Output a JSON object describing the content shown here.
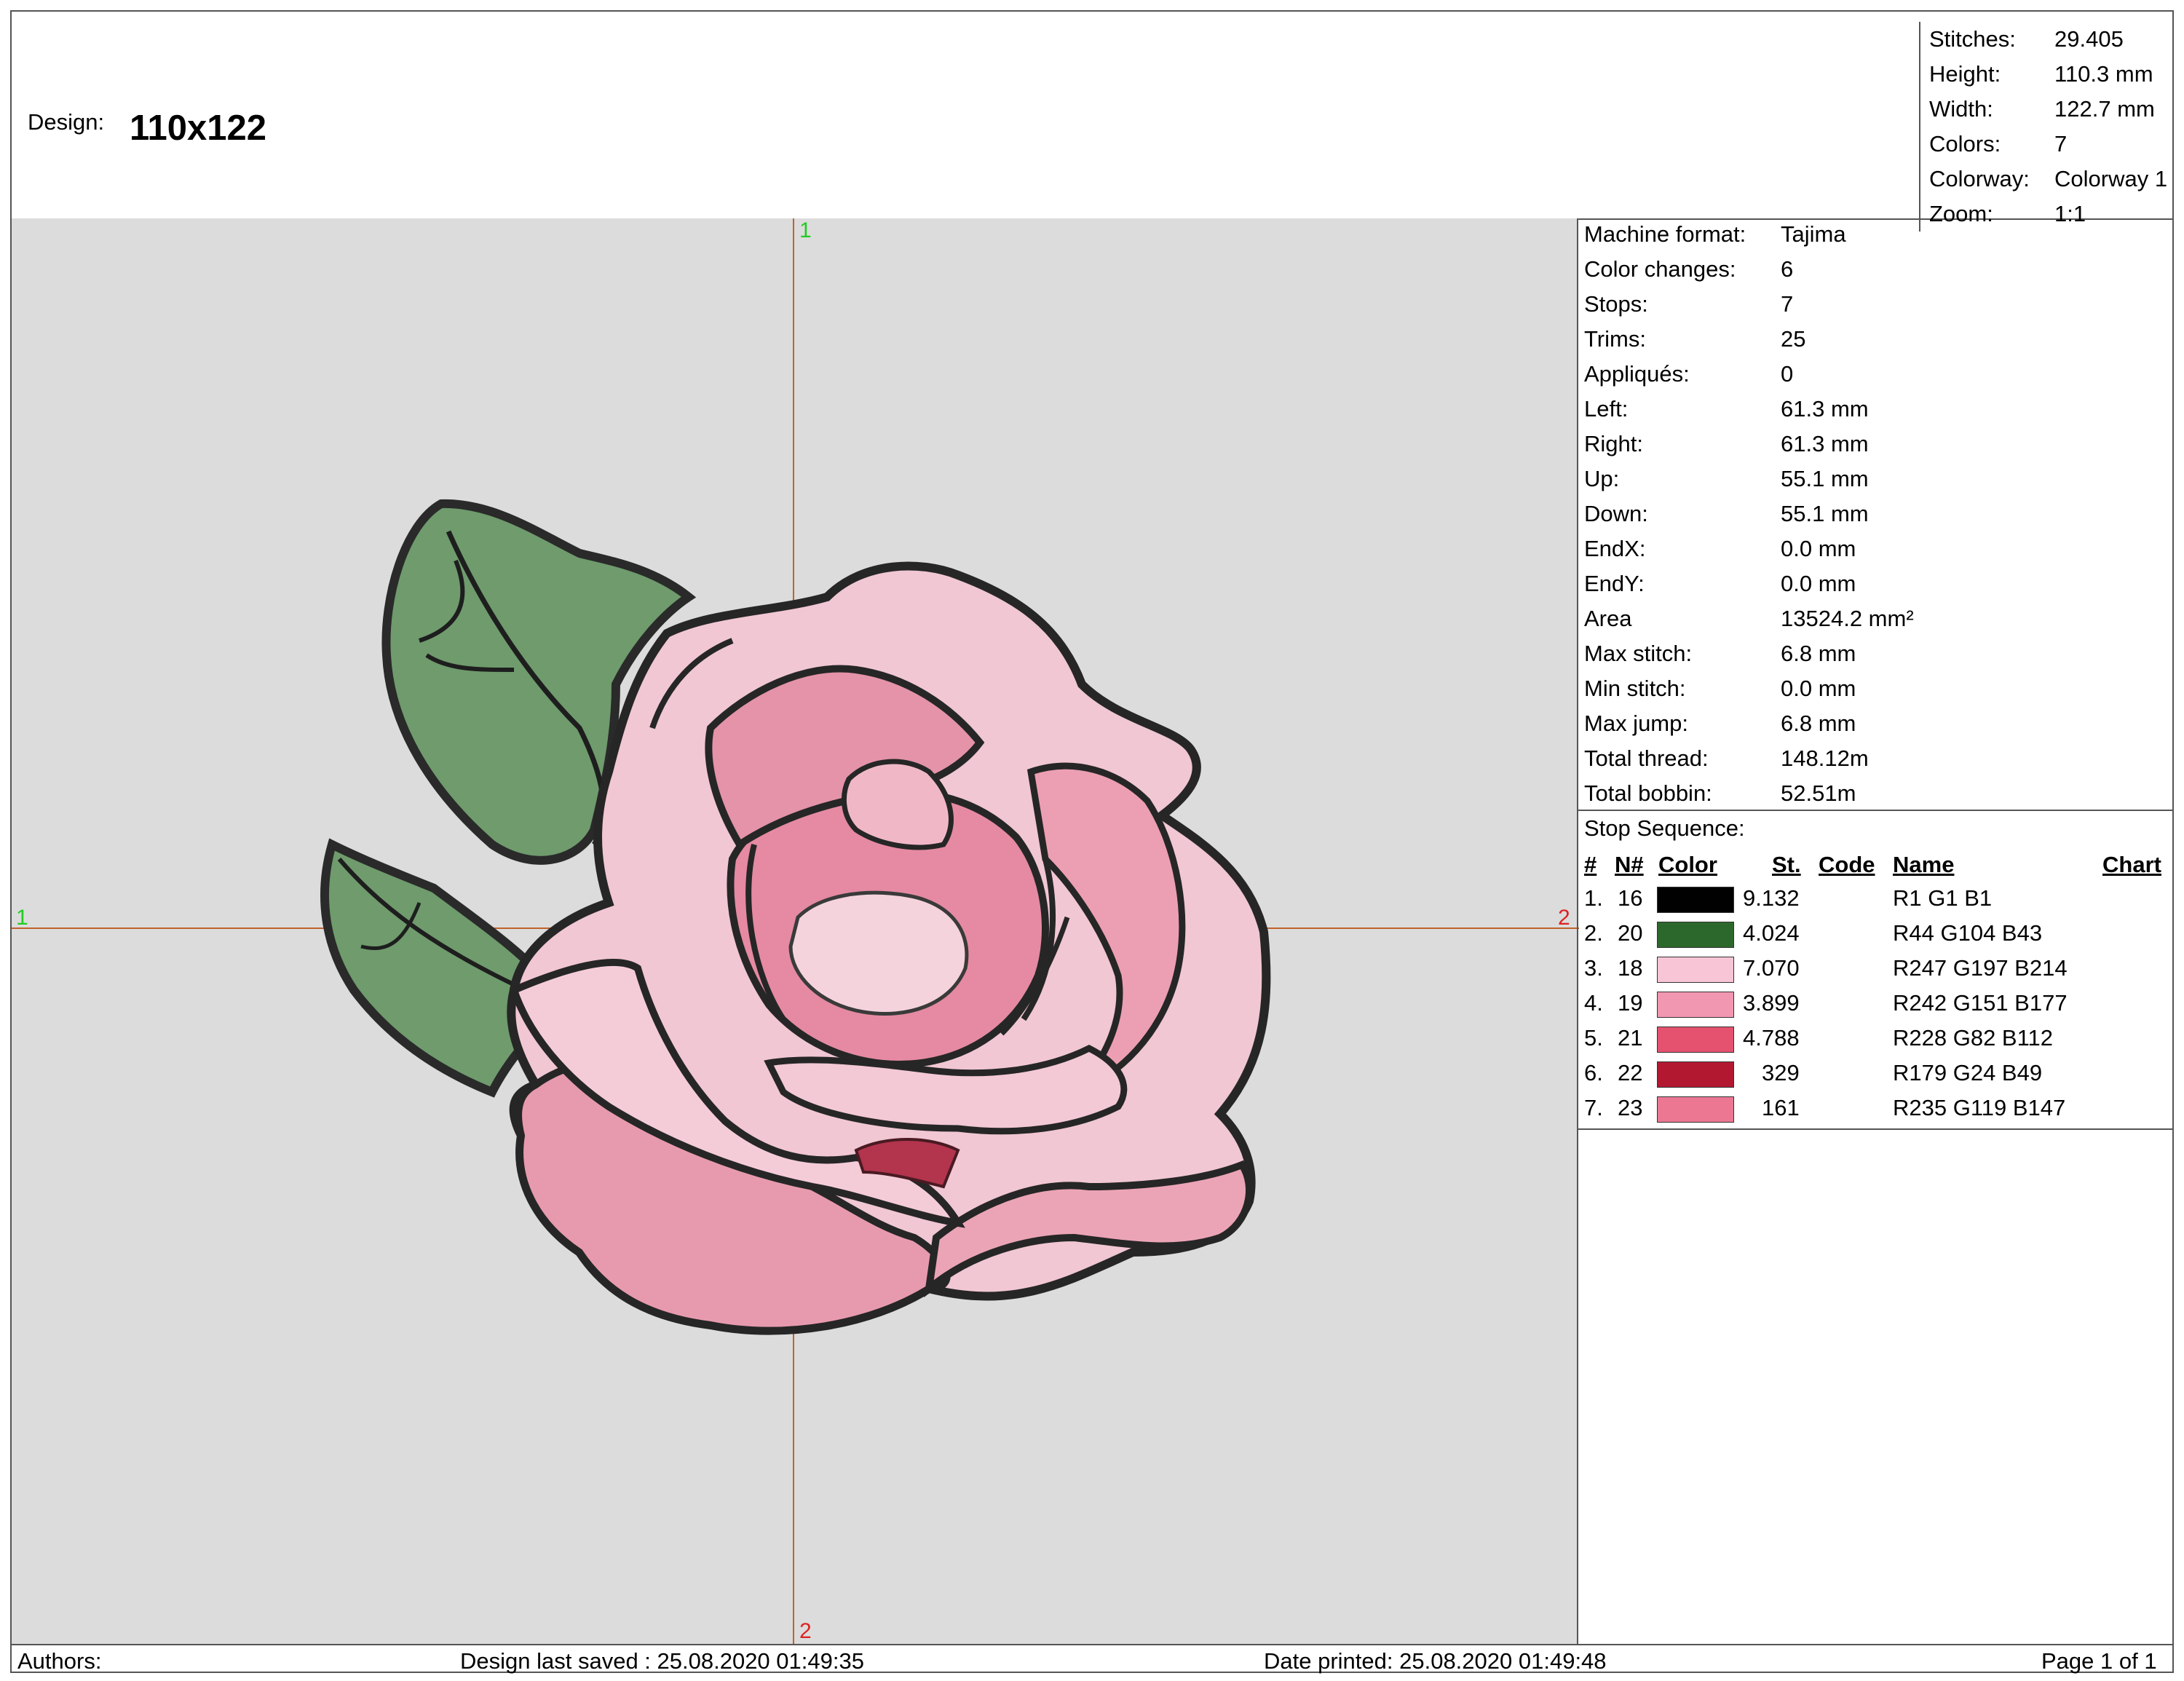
{
  "header": {
    "design_label": "Design:",
    "design_name": "110x122"
  },
  "summary": [
    {
      "label": "Stitches:",
      "value": "29.405"
    },
    {
      "label": "Height:",
      "value": "110.3 mm"
    },
    {
      "label": "Width:",
      "value": "122.7 mm"
    },
    {
      "label": "Colors:",
      "value": "7"
    },
    {
      "label": "Colorway:",
      "value": "Colorway 1"
    },
    {
      "label": "Zoom:",
      "value": "1:1"
    }
  ],
  "info": [
    {
      "label": "Machine format:",
      "value": "Tajima"
    },
    {
      "label": "Color changes:",
      "value": "6"
    },
    {
      "label": "Stops:",
      "value": "7"
    },
    {
      "label": "Trims:",
      "value": "25"
    },
    {
      "label": "Appliqués:",
      "value": "0"
    },
    {
      "label": "Left:",
      "value": "61.3 mm"
    },
    {
      "label": "Right:",
      "value": "61.3 mm"
    },
    {
      "label": "Up:",
      "value": "55.1 mm"
    },
    {
      "label": "Down:",
      "value": "55.1 mm"
    },
    {
      "label": "EndX:",
      "value": "0.0 mm"
    },
    {
      "label": "EndY:",
      "value": "0.0 mm"
    },
    {
      "label": "Area",
      "value": "13524.2 mm²"
    },
    {
      "label": "Max stitch:",
      "value": "6.8 mm"
    },
    {
      "label": "Min stitch:",
      "value": "0.0 mm"
    },
    {
      "label": "Max jump:",
      "value": "6.8 mm"
    },
    {
      "label": "Total thread:",
      "value": "148.12m"
    },
    {
      "label": "Total bobbin:",
      "value": "52.51m"
    }
  ],
  "stop_sequence": {
    "title": "Stop Sequence:",
    "headers": {
      "num": "#",
      "n": "N#",
      "color": "Color",
      "st": "St.",
      "code": "Code",
      "name": "Name",
      "chart": "Chart"
    },
    "rows": [
      {
        "num": "1.",
        "n": "16",
        "color": "#010101",
        "st": "9.132",
        "name": "R1 G1 B1"
      },
      {
        "num": "2.",
        "n": "20",
        "color": "#2c682b",
        "st": "4.024",
        "name": "R44 G104 B43"
      },
      {
        "num": "3.",
        "n": "18",
        "color": "#f7c5d6",
        "st": "7.070",
        "name": "R247 G197 B214"
      },
      {
        "num": "4.",
        "n": "19",
        "color": "#f297b1",
        "st": "3.899",
        "name": "R242 G151 B177"
      },
      {
        "num": "5.",
        "n": "21",
        "color": "#e45270",
        "st": "4.788",
        "name": "R228 G82 B112"
      },
      {
        "num": "6.",
        "n": "22",
        "color": "#b31831",
        "st": "329",
        "name": "R179 G24 B49"
      },
      {
        "num": "7.",
        "n": "23",
        "color": "#eb7793",
        "st": "161",
        "name": "R235 G119 B147"
      }
    ]
  },
  "canvas": {
    "axis_markers": {
      "top": "1",
      "left": "1",
      "right": "2",
      "bottom": "2"
    },
    "axis_color": "#c0622d",
    "start_marker_color": "#22cc22",
    "end_marker_color": "#dd2222"
  },
  "footer": {
    "authors": "Authors:",
    "saved": "Design last saved : 25.08.2020 01:49:35",
    "printed": "Date printed: 25.08.2020 01:49:48",
    "page": "Page 1 of 1"
  }
}
